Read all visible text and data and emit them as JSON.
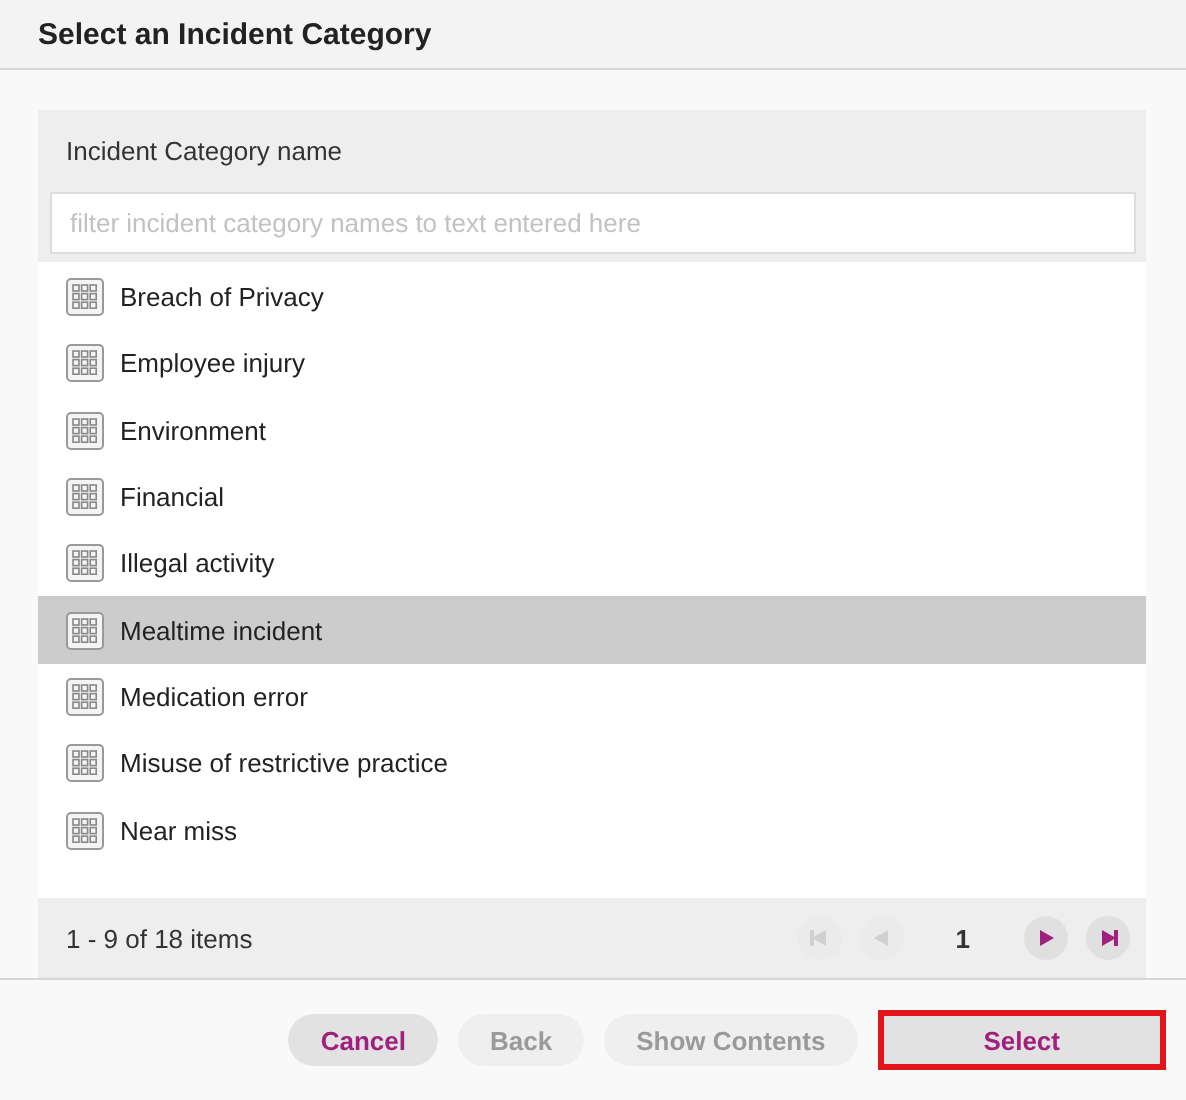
{
  "dialog": {
    "title": "Select an Incident Category"
  },
  "grid": {
    "column": "Incident Category name",
    "filter": {
      "placeholder": "filter incident category names to text entered here"
    },
    "rows": [
      {
        "label": "Breach of Privacy",
        "selected": false
      },
      {
        "label": "Employee injury",
        "selected": false
      },
      {
        "label": "Environment",
        "selected": false
      },
      {
        "label": "Financial",
        "selected": false
      },
      {
        "label": "Illegal activity",
        "selected": false
      },
      {
        "label": "Mealtime incident",
        "selected": true
      },
      {
        "label": "Medication error",
        "selected": false
      },
      {
        "label": "Misuse of restrictive practice",
        "selected": false
      },
      {
        "label": "Near miss",
        "selected": false
      }
    ],
    "pager": {
      "summary": "1 - 9 of 18 items",
      "page": "1",
      "first_disabled": true,
      "prev_disabled": true,
      "next_disabled": false,
      "last_disabled": false
    }
  },
  "buttons": [
    {
      "label": "Cancel",
      "disabled": false,
      "highlighted": false
    },
    {
      "label": "Back",
      "disabled": true,
      "highlighted": false
    },
    {
      "label": "Show Contents",
      "disabled": true,
      "highlighted": false
    },
    {
      "label": "Select",
      "disabled": false,
      "highlighted": true
    }
  ]
}
